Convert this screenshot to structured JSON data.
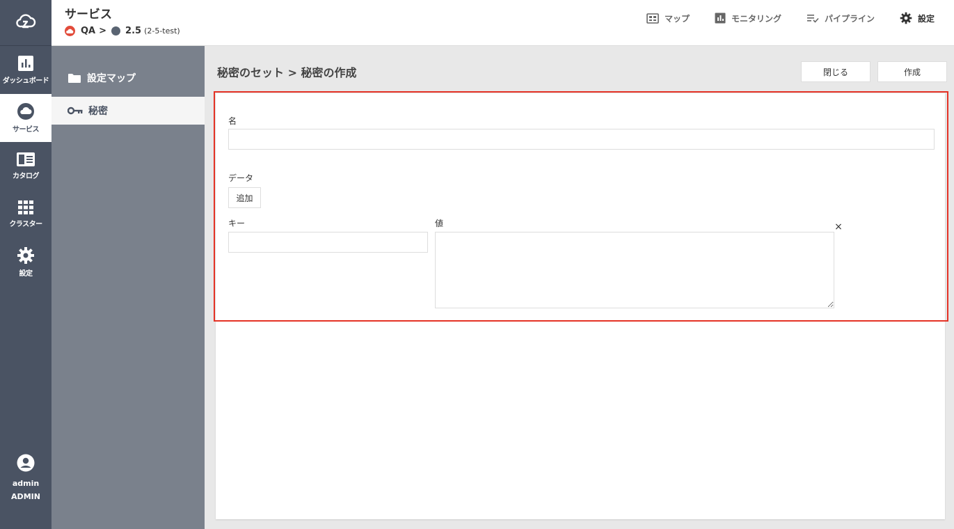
{
  "rail": {
    "items": [
      {
        "label": "ダッシュボード",
        "icon": "chart-bars-icon"
      },
      {
        "label": "サービス",
        "icon": "cloud-icon"
      },
      {
        "label": "カタログ",
        "icon": "book-icon"
      },
      {
        "label": "クラスター",
        "icon": "grid-icon"
      },
      {
        "label": "設定",
        "icon": "gear-icon"
      }
    ],
    "user": {
      "name": "admin",
      "role": "ADMIN"
    }
  },
  "header": {
    "title": "サービス",
    "breadcrumb": {
      "project": "QA",
      "separator": ">",
      "version": "2.5",
      "version_sub": "(2-5-test)"
    },
    "nav": [
      {
        "label": "マップ",
        "icon": "map-icon"
      },
      {
        "label": "モニタリング",
        "icon": "monitoring-icon"
      },
      {
        "label": "パイプライン",
        "icon": "pipeline-icon"
      },
      {
        "label": "設定",
        "icon": "gear-icon"
      }
    ]
  },
  "sidebar": {
    "items": [
      {
        "label": "設定マップ",
        "icon": "folder-icon"
      },
      {
        "label": "秘密",
        "icon": "key-icon"
      }
    ]
  },
  "main": {
    "title": "秘密のセット > 秘密の作成",
    "buttons": {
      "close": "閉じる",
      "create": "作成"
    },
    "form": {
      "name_label": "名",
      "name_value": "",
      "data_label": "データ",
      "add_label": "追加",
      "key_label": "キー",
      "key_value": "",
      "value_label": "値",
      "value_value": "",
      "remove_glyph": "×"
    }
  },
  "colors": {
    "rail": "#4a5363",
    "sidebar": "#7a818c",
    "highlight": "#e53225",
    "project_dot": "#e24c3b"
  }
}
